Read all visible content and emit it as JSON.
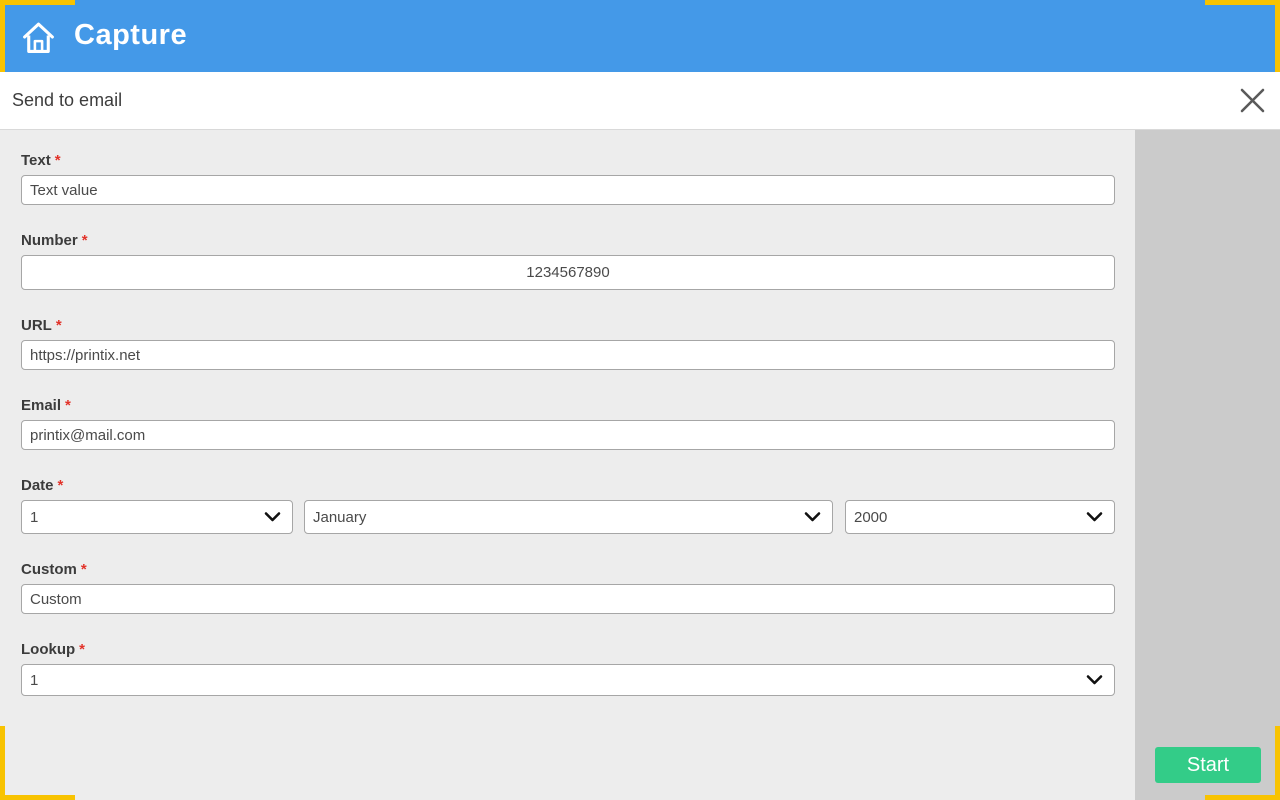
{
  "app": {
    "title": "Capture",
    "header_color": "#4499E8",
    "accent_yellow": "#F8C301"
  },
  "dialog": {
    "title": "Send to email",
    "close_icon": "x-icon"
  },
  "form": {
    "required_marker": "*",
    "background_color": "#EDEDED",
    "fields": {
      "text": {
        "label": "Text",
        "value": "Text value"
      },
      "number": {
        "label": "Number",
        "value": "1234567890"
      },
      "url": {
        "label": "URL",
        "value": "https://printix.net"
      },
      "email": {
        "label": "Email",
        "value": "printix@mail.com"
      },
      "date": {
        "label": "Date",
        "day": "1",
        "month": "January",
        "year": "2000"
      },
      "custom": {
        "label": "Custom",
        "value": "Custom"
      },
      "lookup": {
        "label": "Lookup",
        "value": "1"
      }
    }
  },
  "actions": {
    "start_label": "Start",
    "start_color": "#33CC88",
    "panel_color": "#CBCBCB"
  }
}
